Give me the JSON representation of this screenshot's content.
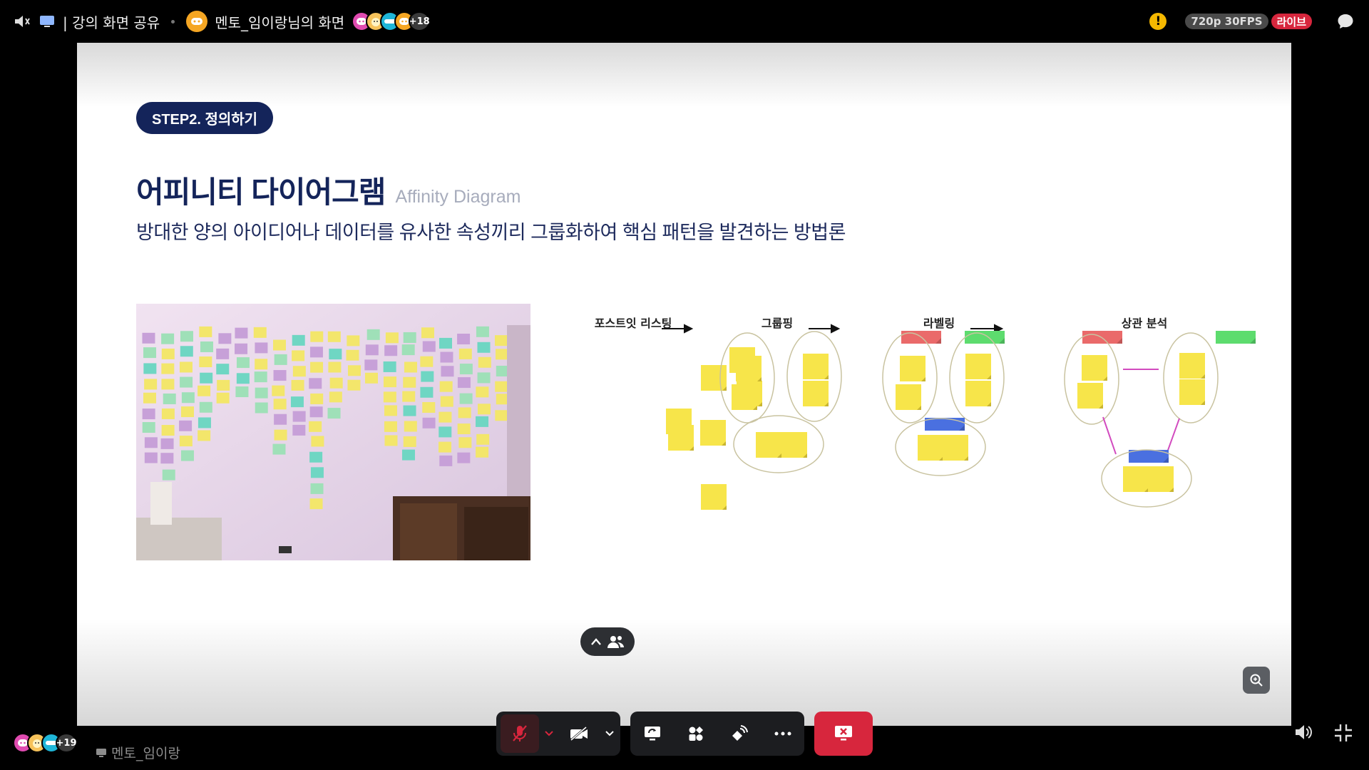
{
  "topbar": {
    "section_title": "| 강의 화면 공유",
    "stream_title": "멘토_임이랑님의 화면",
    "viewer_count": "+18",
    "quality": "720p 30FPS",
    "live": "라이브",
    "warning": "!"
  },
  "slide": {
    "step_label": "STEP2. 정의하기",
    "heading": "어피니티 다이어그램",
    "heading_en": "Affinity Diagram",
    "description": "방대한 양의 아이디어나 데이터를 유사한 속성끼리 그룹화하여 핵심 패턴을 발견하는 방법론",
    "stages": [
      "포스트잇 리스팅",
      "그룹핑",
      "라벨링",
      "상관 분석"
    ]
  },
  "bottom": {
    "participant_count": "+19",
    "username": "멘토_임이랑"
  },
  "colors": {
    "navy": "#14245a",
    "sticky_yellow": "#f7e54a",
    "label_red": "#ea6a6a",
    "label_green": "#5ddc6e",
    "label_blue": "#4a70e0",
    "live_red": "#d7263d"
  }
}
